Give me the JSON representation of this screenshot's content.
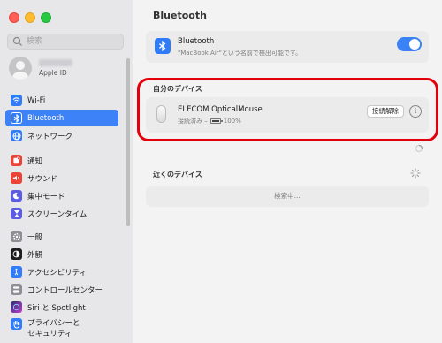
{
  "window": {
    "controls": [
      "close",
      "minimize",
      "zoom"
    ]
  },
  "sidebar": {
    "search_placeholder": "検索",
    "apple_id_label": "Apple ID",
    "items": [
      {
        "label": "Wi-Fi",
        "icon": "wifi-icon",
        "color": "#2f7cf6"
      },
      {
        "label": "Bluetooth",
        "icon": "bluetooth-icon",
        "color": "#2f7cf6",
        "active": true
      },
      {
        "label": "ネットワーク",
        "icon": "globe-icon",
        "color": "#2f7cf6"
      },
      {
        "label": "通知",
        "icon": "bell-icon",
        "color": "#ea4335"
      },
      {
        "label": "サウンド",
        "icon": "speaker-icon",
        "color": "#ea4335"
      },
      {
        "label": "集中モード",
        "icon": "moon-icon",
        "color": "#5b5ce2"
      },
      {
        "label": "スクリーンタイム",
        "icon": "hourglass-icon",
        "color": "#5b5ce2"
      },
      {
        "label": "一般",
        "icon": "gear-icon",
        "color": "#8e8e93"
      },
      {
        "label": "外観",
        "icon": "appearance-icon",
        "color": "#1c1c1c"
      },
      {
        "label": "アクセシビリティ",
        "icon": "accessibility-icon",
        "color": "#2f7cf6"
      },
      {
        "label": "コントロールセンター",
        "icon": "control-center-icon",
        "color": "#8e8e93"
      },
      {
        "label": "Siri と Spotlight",
        "icon": "siri-icon",
        "color": "#6a4de8"
      },
      {
        "label": "プライバシーと",
        "label2": "セキュリティ",
        "icon": "hand-icon",
        "color": "#2f7cf6"
      }
    ]
  },
  "main": {
    "title": "Bluetooth",
    "bluetooth": {
      "name": "Bluetooth",
      "description": "\"MacBook Air\"という名前で検出可能です。",
      "enabled": true
    },
    "my_devices_label": "自分のデバイス",
    "device": {
      "name": "ELECOM OpticalMouse",
      "status": "接続済み –",
      "battery": "100%",
      "battery_level": 1.0,
      "disconnect_label": "接続解除"
    },
    "nearby_label": "近くのデバイス",
    "searching": "検索中..."
  },
  "colors": {
    "accent": "#3d82f6",
    "highlight": "#e3000b"
  }
}
